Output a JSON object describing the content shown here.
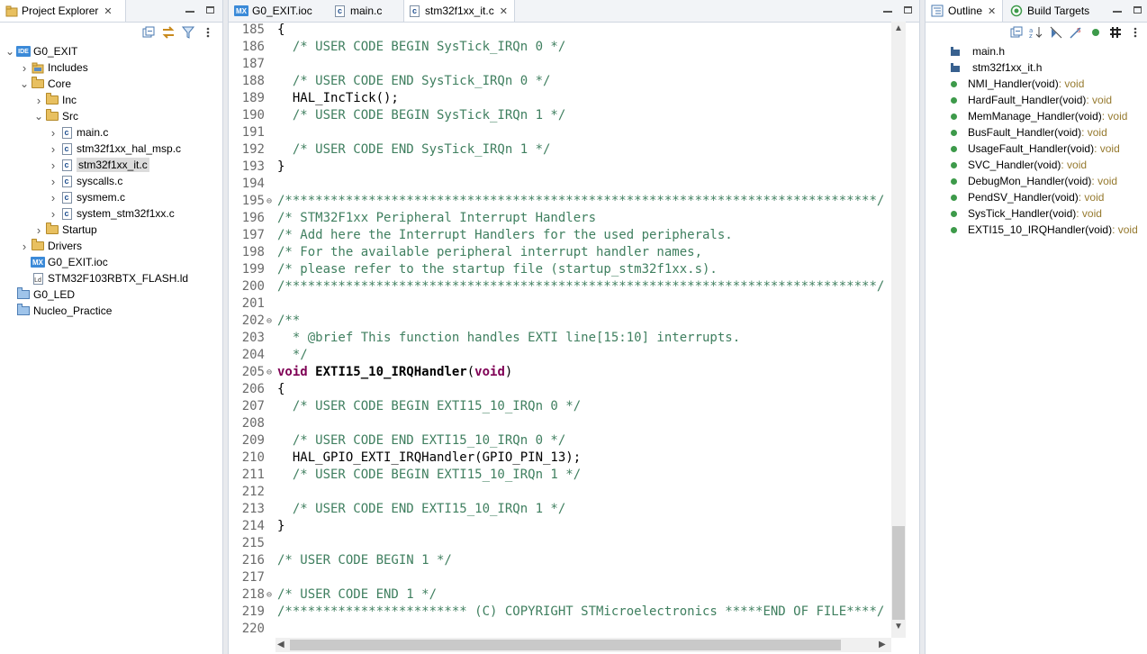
{
  "colors": {
    "comment": "#3f7f5f",
    "keyword": "#7f0055",
    "outline_dot": "#3d9a4a",
    "type_suffix": "#967a2f"
  },
  "project_explorer": {
    "tab_label": "Project Explorer",
    "toolbar_icons": [
      "collapse-all-icon",
      "link-editor-icon",
      "filter-icon",
      "view-menu-icon"
    ],
    "tree": [
      {
        "label": "G0_EXIT",
        "icon": "ide-project-icon",
        "depth": 0,
        "expanded": true
      },
      {
        "label": "Includes",
        "icon": "includes-icon",
        "depth": 1,
        "expanded": false
      },
      {
        "label": "Core",
        "icon": "folder-icon",
        "depth": 1,
        "expanded": true
      },
      {
        "label": "Inc",
        "icon": "folder-icon",
        "depth": 2,
        "expanded": false
      },
      {
        "label": "Src",
        "icon": "folder-icon",
        "depth": 2,
        "expanded": true
      },
      {
        "label": "main.c",
        "icon": "c-file-icon",
        "depth": 3,
        "expanded": false
      },
      {
        "label": "stm32f1xx_hal_msp.c",
        "icon": "c-file-icon",
        "depth": 3,
        "expanded": false
      },
      {
        "label": "stm32f1xx_it.c",
        "icon": "c-file-icon",
        "depth": 3,
        "expanded": false,
        "selected": true
      },
      {
        "label": "syscalls.c",
        "icon": "c-file-icon",
        "depth": 3,
        "expanded": false
      },
      {
        "label": "sysmem.c",
        "icon": "c-file-icon",
        "depth": 3,
        "expanded": false
      },
      {
        "label": "system_stm32f1xx.c",
        "icon": "c-file-icon",
        "depth": 3,
        "expanded": false
      },
      {
        "label": "Startup",
        "icon": "folder-icon",
        "depth": 2,
        "expanded": false
      },
      {
        "label": "Drivers",
        "icon": "folder-icon",
        "depth": 1,
        "expanded": false
      },
      {
        "label": "G0_EXIT.ioc",
        "icon": "mx-file-icon",
        "depth": 1,
        "leaf": true
      },
      {
        "label": "STM32F103RBTX_FLASH.ld",
        "icon": "ld-file-icon",
        "depth": 1,
        "leaf": true
      },
      {
        "label": "G0_LED",
        "icon": "project-folder-icon",
        "depth": 0,
        "leaf": true
      },
      {
        "label": "Nucleo_Practice",
        "icon": "project-folder-icon",
        "depth": 0,
        "leaf": true
      }
    ]
  },
  "editor": {
    "tabs": [
      {
        "label": "G0_EXIT.ioc",
        "icon": "mx-file-icon",
        "active": false
      },
      {
        "label": "main.c",
        "icon": "c-file-icon",
        "active": false
      },
      {
        "label": "stm32f1xx_it.c",
        "icon": "c-file-icon",
        "active": true
      }
    ],
    "lines": [
      {
        "n": "185",
        "fold": false,
        "segs": [
          {
            "t": "{",
            "c": "tx"
          }
        ]
      },
      {
        "n": "186",
        "fold": false,
        "segs": [
          {
            "t": "  /* USER CODE BEGIN SysTick_IRQn 0 */",
            "c": "cm"
          }
        ]
      },
      {
        "n": "187",
        "fold": false,
        "segs": []
      },
      {
        "n": "188",
        "fold": false,
        "segs": [
          {
            "t": "  /* USER CODE END SysTick_IRQn 0 */",
            "c": "cm"
          }
        ]
      },
      {
        "n": "189",
        "fold": false,
        "segs": [
          {
            "t": "  HAL_IncTick();",
            "c": "tx"
          }
        ]
      },
      {
        "n": "190",
        "fold": false,
        "segs": [
          {
            "t": "  /* USER CODE BEGIN SysTick_IRQn 1 */",
            "c": "cm"
          }
        ]
      },
      {
        "n": "191",
        "fold": false,
        "segs": []
      },
      {
        "n": "192",
        "fold": false,
        "segs": [
          {
            "t": "  /* USER CODE END SysTick_IRQn 1 */",
            "c": "cm"
          }
        ]
      },
      {
        "n": "193",
        "fold": false,
        "segs": [
          {
            "t": "}",
            "c": "tx"
          }
        ]
      },
      {
        "n": "194",
        "fold": false,
        "segs": []
      },
      {
        "n": "195",
        "fold": true,
        "segs": [
          {
            "t": "/******************************************************************************/",
            "c": "cm"
          }
        ]
      },
      {
        "n": "196",
        "fold": false,
        "segs": [
          {
            "t": "/* STM32F1xx Peripheral Interrupt Handlers",
            "c": "cm"
          }
        ]
      },
      {
        "n": "197",
        "fold": false,
        "segs": [
          {
            "t": "/* Add here the Interrupt Handlers for the used peripherals.",
            "c": "cm"
          }
        ]
      },
      {
        "n": "198",
        "fold": false,
        "segs": [
          {
            "t": "/* For the available peripheral interrupt handler names,",
            "c": "cm"
          }
        ]
      },
      {
        "n": "199",
        "fold": false,
        "segs": [
          {
            "t": "/* please refer to the startup file (startup_stm32f1xx.s).",
            "c": "cm"
          }
        ]
      },
      {
        "n": "200",
        "fold": false,
        "segs": [
          {
            "t": "/******************************************************************************/",
            "c": "cm"
          }
        ]
      },
      {
        "n": "201",
        "fold": false,
        "segs": []
      },
      {
        "n": "202",
        "fold": true,
        "segs": [
          {
            "t": "/**",
            "c": "cm"
          }
        ]
      },
      {
        "n": "203",
        "fold": false,
        "segs": [
          {
            "t": "  * @brief This function handles EXTI line[15:10] interrupts.",
            "c": "cm"
          }
        ]
      },
      {
        "n": "204",
        "fold": false,
        "segs": [
          {
            "t": "  */",
            "c": "cm"
          }
        ]
      },
      {
        "n": "205",
        "fold": true,
        "segs": [
          {
            "t": "void",
            "c": "kw"
          },
          {
            "t": " ",
            "c": "tx"
          },
          {
            "t": "EXTI15_10_IRQHandler",
            "c": "fn"
          },
          {
            "t": "(",
            "c": "tx"
          },
          {
            "t": "void",
            "c": "kw"
          },
          {
            "t": ")",
            "c": "tx"
          }
        ]
      },
      {
        "n": "206",
        "fold": false,
        "segs": [
          {
            "t": "{",
            "c": "tx"
          }
        ]
      },
      {
        "n": "207",
        "fold": false,
        "segs": [
          {
            "t": "  /* USER CODE BEGIN EXTI15_10_IRQn 0 */",
            "c": "cm"
          }
        ]
      },
      {
        "n": "208",
        "fold": false,
        "segs": []
      },
      {
        "n": "209",
        "fold": false,
        "segs": [
          {
            "t": "  /* USER CODE END EXTI15_10_IRQn 0 */",
            "c": "cm"
          }
        ]
      },
      {
        "n": "210",
        "fold": false,
        "segs": [
          {
            "t": "  HAL_GPIO_EXTI_IRQHandler(GPIO_PIN_13);",
            "c": "tx"
          }
        ]
      },
      {
        "n": "211",
        "fold": false,
        "segs": [
          {
            "t": "  /* USER CODE BEGIN EXTI15_10_IRQn 1 */",
            "c": "cm"
          }
        ]
      },
      {
        "n": "212",
        "fold": false,
        "segs": []
      },
      {
        "n": "213",
        "fold": false,
        "segs": [
          {
            "t": "  /* USER CODE END EXTI15_10_IRQn 1 */",
            "c": "cm"
          }
        ]
      },
      {
        "n": "214",
        "fold": false,
        "segs": [
          {
            "t": "}",
            "c": "tx"
          }
        ]
      },
      {
        "n": "215",
        "fold": false,
        "segs": []
      },
      {
        "n": "216",
        "fold": false,
        "segs": [
          {
            "t": "/* USER CODE BEGIN 1 */",
            "c": "cm"
          }
        ]
      },
      {
        "n": "217",
        "fold": false,
        "segs": []
      },
      {
        "n": "218",
        "fold": true,
        "segs": [
          {
            "t": "/* USER CODE END 1 */",
            "c": "cm"
          }
        ]
      },
      {
        "n": "219",
        "fold": false,
        "segs": [
          {
            "t": "/************************ (C) COPYRIGHT STMicroelectronics *****END OF FILE****/",
            "c": "cm"
          }
        ]
      },
      {
        "n": "220",
        "fold": false,
        "segs": []
      }
    ]
  },
  "outline": {
    "tabs": [
      {
        "label": "Outline",
        "icon": "outline-icon",
        "active": true
      },
      {
        "label": "Build Targets",
        "icon": "build-targets-icon",
        "active": false
      }
    ],
    "toolbar_icons": [
      "collapse-all-icon",
      "sort-icon",
      "hide-fields-icon",
      "hide-static-icon",
      "hide-non-public-icon",
      "hash-icon",
      "view-menu-icon"
    ],
    "items": [
      {
        "name": "main.h",
        "type": "",
        "icon": "include-icon"
      },
      {
        "name": "stm32f1xx_it.h",
        "type": "",
        "icon": "include-icon"
      },
      {
        "name": "NMI_Handler(void)",
        "type": " : void",
        "icon": "function-icon"
      },
      {
        "name": "HardFault_Handler(void)",
        "type": " : void",
        "icon": "function-icon"
      },
      {
        "name": "MemManage_Handler(void)",
        "type": " : void",
        "icon": "function-icon"
      },
      {
        "name": "BusFault_Handler(void)",
        "type": " : void",
        "icon": "function-icon"
      },
      {
        "name": "UsageFault_Handler(void)",
        "type": " : void",
        "icon": "function-icon"
      },
      {
        "name": "SVC_Handler(void)",
        "type": " : void",
        "icon": "function-icon"
      },
      {
        "name": "DebugMon_Handler(void)",
        "type": " : void",
        "icon": "function-icon"
      },
      {
        "name": "PendSV_Handler(void)",
        "type": " : void",
        "icon": "function-icon"
      },
      {
        "name": "SysTick_Handler(void)",
        "type": " : void",
        "icon": "function-icon"
      },
      {
        "name": "EXTI15_10_IRQHandler(void)",
        "type": " : void",
        "icon": "function-icon"
      }
    ]
  }
}
